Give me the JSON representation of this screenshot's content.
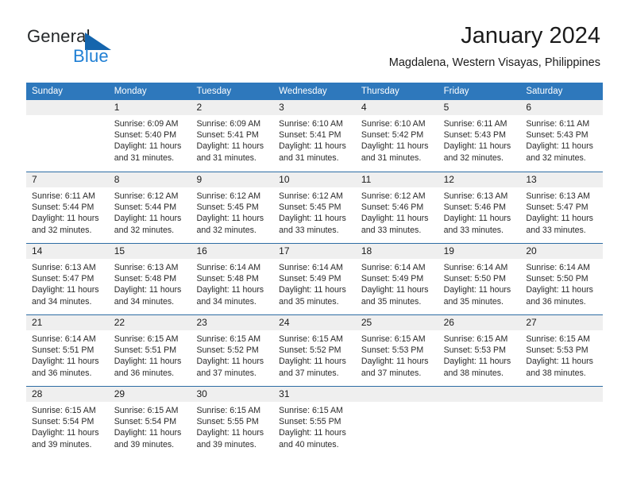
{
  "brand": {
    "word1": "General",
    "word2": "Blue",
    "triangle_color": "#1565ad",
    "blue_color": "#1f7fd4"
  },
  "header": {
    "title": "January 2024",
    "subtitle": "Magdalena, Western Visayas, Philippines"
  },
  "theme": {
    "header_band": "#2e78bc",
    "day_band": "#efefef",
    "row_divider": "#2e6da4"
  },
  "calendar": {
    "weekday_headers": [
      "Sunday",
      "Monday",
      "Tuesday",
      "Wednesday",
      "Thursday",
      "Friday",
      "Saturday"
    ],
    "weeks": [
      [
        {
          "day": "",
          "lines": []
        },
        {
          "day": "1",
          "lines": [
            "Sunrise: 6:09 AM",
            "Sunset: 5:40 PM",
            "Daylight: 11 hours",
            "and 31 minutes."
          ]
        },
        {
          "day": "2",
          "lines": [
            "Sunrise: 6:09 AM",
            "Sunset: 5:41 PM",
            "Daylight: 11 hours",
            "and 31 minutes."
          ]
        },
        {
          "day": "3",
          "lines": [
            "Sunrise: 6:10 AM",
            "Sunset: 5:41 PM",
            "Daylight: 11 hours",
            "and 31 minutes."
          ]
        },
        {
          "day": "4",
          "lines": [
            "Sunrise: 6:10 AM",
            "Sunset: 5:42 PM",
            "Daylight: 11 hours",
            "and 31 minutes."
          ]
        },
        {
          "day": "5",
          "lines": [
            "Sunrise: 6:11 AM",
            "Sunset: 5:43 PM",
            "Daylight: 11 hours",
            "and 32 minutes."
          ]
        },
        {
          "day": "6",
          "lines": [
            "Sunrise: 6:11 AM",
            "Sunset: 5:43 PM",
            "Daylight: 11 hours",
            "and 32 minutes."
          ]
        }
      ],
      [
        {
          "day": "7",
          "lines": [
            "Sunrise: 6:11 AM",
            "Sunset: 5:44 PM",
            "Daylight: 11 hours",
            "and 32 minutes."
          ]
        },
        {
          "day": "8",
          "lines": [
            "Sunrise: 6:12 AM",
            "Sunset: 5:44 PM",
            "Daylight: 11 hours",
            "and 32 minutes."
          ]
        },
        {
          "day": "9",
          "lines": [
            "Sunrise: 6:12 AM",
            "Sunset: 5:45 PM",
            "Daylight: 11 hours",
            "and 32 minutes."
          ]
        },
        {
          "day": "10",
          "lines": [
            "Sunrise: 6:12 AM",
            "Sunset: 5:45 PM",
            "Daylight: 11 hours",
            "and 33 minutes."
          ]
        },
        {
          "day": "11",
          "lines": [
            "Sunrise: 6:12 AM",
            "Sunset: 5:46 PM",
            "Daylight: 11 hours",
            "and 33 minutes."
          ]
        },
        {
          "day": "12",
          "lines": [
            "Sunrise: 6:13 AM",
            "Sunset: 5:46 PM",
            "Daylight: 11 hours",
            "and 33 minutes."
          ]
        },
        {
          "day": "13",
          "lines": [
            "Sunrise: 6:13 AM",
            "Sunset: 5:47 PM",
            "Daylight: 11 hours",
            "and 33 minutes."
          ]
        }
      ],
      [
        {
          "day": "14",
          "lines": [
            "Sunrise: 6:13 AM",
            "Sunset: 5:47 PM",
            "Daylight: 11 hours",
            "and 34 minutes."
          ]
        },
        {
          "day": "15",
          "lines": [
            "Sunrise: 6:13 AM",
            "Sunset: 5:48 PM",
            "Daylight: 11 hours",
            "and 34 minutes."
          ]
        },
        {
          "day": "16",
          "lines": [
            "Sunrise: 6:14 AM",
            "Sunset: 5:48 PM",
            "Daylight: 11 hours",
            "and 34 minutes."
          ]
        },
        {
          "day": "17",
          "lines": [
            "Sunrise: 6:14 AM",
            "Sunset: 5:49 PM",
            "Daylight: 11 hours",
            "and 35 minutes."
          ]
        },
        {
          "day": "18",
          "lines": [
            "Sunrise: 6:14 AM",
            "Sunset: 5:49 PM",
            "Daylight: 11 hours",
            "and 35 minutes."
          ]
        },
        {
          "day": "19",
          "lines": [
            "Sunrise: 6:14 AM",
            "Sunset: 5:50 PM",
            "Daylight: 11 hours",
            "and 35 minutes."
          ]
        },
        {
          "day": "20",
          "lines": [
            "Sunrise: 6:14 AM",
            "Sunset: 5:50 PM",
            "Daylight: 11 hours",
            "and 36 minutes."
          ]
        }
      ],
      [
        {
          "day": "21",
          "lines": [
            "Sunrise: 6:14 AM",
            "Sunset: 5:51 PM",
            "Daylight: 11 hours",
            "and 36 minutes."
          ]
        },
        {
          "day": "22",
          "lines": [
            "Sunrise: 6:15 AM",
            "Sunset: 5:51 PM",
            "Daylight: 11 hours",
            "and 36 minutes."
          ]
        },
        {
          "day": "23",
          "lines": [
            "Sunrise: 6:15 AM",
            "Sunset: 5:52 PM",
            "Daylight: 11 hours",
            "and 37 minutes."
          ]
        },
        {
          "day": "24",
          "lines": [
            "Sunrise: 6:15 AM",
            "Sunset: 5:52 PM",
            "Daylight: 11 hours",
            "and 37 minutes."
          ]
        },
        {
          "day": "25",
          "lines": [
            "Sunrise: 6:15 AM",
            "Sunset: 5:53 PM",
            "Daylight: 11 hours",
            "and 37 minutes."
          ]
        },
        {
          "day": "26",
          "lines": [
            "Sunrise: 6:15 AM",
            "Sunset: 5:53 PM",
            "Daylight: 11 hours",
            "and 38 minutes."
          ]
        },
        {
          "day": "27",
          "lines": [
            "Sunrise: 6:15 AM",
            "Sunset: 5:53 PM",
            "Daylight: 11 hours",
            "and 38 minutes."
          ]
        }
      ],
      [
        {
          "day": "28",
          "lines": [
            "Sunrise: 6:15 AM",
            "Sunset: 5:54 PM",
            "Daylight: 11 hours",
            "and 39 minutes."
          ]
        },
        {
          "day": "29",
          "lines": [
            "Sunrise: 6:15 AM",
            "Sunset: 5:54 PM",
            "Daylight: 11 hours",
            "and 39 minutes."
          ]
        },
        {
          "day": "30",
          "lines": [
            "Sunrise: 6:15 AM",
            "Sunset: 5:55 PM",
            "Daylight: 11 hours",
            "and 39 minutes."
          ]
        },
        {
          "day": "31",
          "lines": [
            "Sunrise: 6:15 AM",
            "Sunset: 5:55 PM",
            "Daylight: 11 hours",
            "and 40 minutes."
          ]
        },
        {
          "day": "",
          "lines": []
        },
        {
          "day": "",
          "lines": []
        },
        {
          "day": "",
          "lines": []
        }
      ]
    ]
  }
}
